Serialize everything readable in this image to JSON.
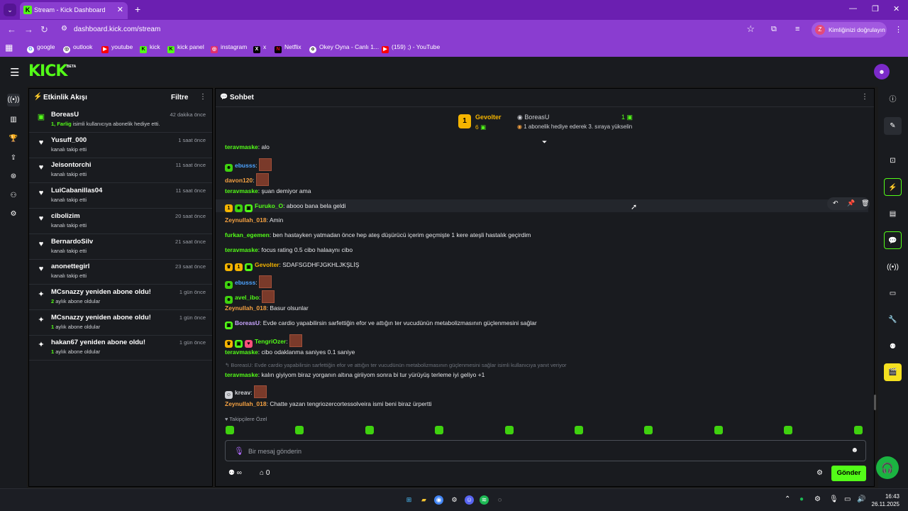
{
  "browser": {
    "tab_title": "Stream - Kick Dashboard",
    "url": "dashboard.kick.com/stream",
    "profile_label": "Kimliğinizi doğrulayın",
    "profile_initial": "Z",
    "bookmarks": [
      "google",
      "outlook",
      "youtube",
      "kick",
      "kick panel",
      "instagram",
      "x",
      "Netflix",
      "Okey Oyna - Canlı 1...",
      "(159) ;) - YouTube"
    ]
  },
  "kick": {
    "logo": "KICK",
    "beta": "BETA"
  },
  "activity": {
    "title": "Etkinlik Akışı",
    "filter_label": "Filtre",
    "events": [
      {
        "icon": "gift-icon",
        "name": "BoreasU",
        "sub_strong": "1, Farlig",
        "sub": " isimli kullanıcıya abonelik hediye etti.",
        "time": "42 dakika önce",
        "color": "#53fc18"
      },
      {
        "icon": "heart-icon",
        "name": "Yusuff_000",
        "sub_strong": "",
        "sub": "kanalı takip etti",
        "time": "1 saat önce",
        "color": "#ffffff"
      },
      {
        "icon": "heart-icon",
        "name": "Jeisontorchi",
        "sub_strong": "",
        "sub": "kanalı takip etti",
        "time": "11 saat önce",
        "color": "#ffffff"
      },
      {
        "icon": "heart-icon",
        "name": "LuiCabanillas04",
        "sub_strong": "",
        "sub": "kanalı takip etti",
        "time": "11 saat önce",
        "color": "#ffffff"
      },
      {
        "icon": "heart-icon",
        "name": "cibolizim",
        "sub_strong": "",
        "sub": "kanalı takip etti",
        "time": "20 saat önce",
        "color": "#ffffff"
      },
      {
        "icon": "heart-icon",
        "name": "BernardoSilv",
        "sub_strong": "",
        "sub": "kanalı takip etti",
        "time": "21 saat önce",
        "color": "#ffffff"
      },
      {
        "icon": "heart-icon",
        "name": "anonettegirl",
        "sub_strong": "",
        "sub": "kanalı takip etti",
        "time": "23 saat önce",
        "color": "#ffffff"
      },
      {
        "icon": "sparkle-icon",
        "name": "MCsnazzy yeniden abone oldu!",
        "sub_strong": "2",
        "sub": " aylık abone oldular",
        "time": "1 gün önce",
        "color": "#ffffff"
      },
      {
        "icon": "sparkle-icon",
        "name": "MCsnazzy yeniden abone oldu!",
        "sub_strong": "1",
        "sub": " aylık abone oldular",
        "time": "1 gün önce",
        "color": "#ffffff"
      },
      {
        "icon": "sparkle-icon",
        "name": "hakan67 yeniden abone oldu!",
        "sub_strong": "1",
        "sub": " aylık abone oldular",
        "time": "1 gün önce",
        "color": "#ffffff"
      }
    ]
  },
  "chat": {
    "title": "Sohbet",
    "pinned": {
      "rank_badge": "1",
      "name": "Gevolter",
      "count": "6",
      "user": "BoreasU",
      "rank": "1",
      "desc": "1 abonelik hediye ederek 3. sıraya yükselin"
    },
    "messages": [
      {
        "user": "teravmaske",
        "color": "#53fc18",
        "text": ": alo",
        "emote": false,
        "badges": []
      },
      {
        "user": "ebusss",
        "color": "#4da3ff",
        "text": ":",
        "emote": true,
        "badges": [
          "frog"
        ]
      },
      {
        "user": "davon120",
        "color": "#f4a142",
        "text": ":",
        "emote": true,
        "badges": []
      },
      {
        "user": "teravmaske",
        "color": "#53fc18",
        "text": ": şuan demiyor ama",
        "emote": false,
        "badges": []
      },
      {
        "user": "Furuko_O",
        "color": "#53fc18",
        "text": ": abooo bana bela geldi",
        "emote": false,
        "badges": [
          "gold",
          "frog",
          "gift"
        ]
      },
      {
        "user": "Zeynullah_018",
        "color": "#f4a142",
        "text": ": Amin",
        "emote": false,
        "badges": []
      },
      {
        "user": "furkan_egemen",
        "color": "#53fc18",
        "text": ": ben hastayken yatmadan önce hep ateş düşürücü içerim geçmişte 1 kere ateşli hastalık geçirdim",
        "emote": false,
        "badges": []
      },
      {
        "user": "teravmaske",
        "color": "#53fc18",
        "text": ": focus rating 0.5 cibo halaaynı cibo",
        "emote": false,
        "badges": []
      },
      {
        "user": "Gevolter",
        "color": "#f4b400",
        "text": ": SDAFSGDHFJGKHLJKŞLİŞ",
        "emote": false,
        "badges": [
          "crown",
          "gold",
          "gift"
        ]
      },
      {
        "user": "ebusss",
        "color": "#4da3ff",
        "text": ":",
        "emote": true,
        "badges": [
          "frog"
        ]
      },
      {
        "user": "avel_ibo",
        "color": "#53fc18",
        "text": ":",
        "emote": true,
        "badges": [
          "frog"
        ]
      },
      {
        "user": "Zeynullah_018",
        "color": "#f4a142",
        "text": ": Basur olsunlar",
        "emote": false,
        "badges": []
      },
      {
        "user": "BoreasU",
        "color": "#c9a5ff",
        "text": ": Evde cardio yapabilirsin sarfettiğin efor ve attığın ter vucudünün metabolizmasının güçlenmesini sağlar",
        "emote": false,
        "badges": [
          "gift"
        ]
      },
      {
        "user": "TengriOzer",
        "color": "#53fc18",
        "text": ":",
        "emote": true,
        "badges": [
          "crown",
          "gift",
          "heart"
        ]
      },
      {
        "user": "teravmaske",
        "color": "#53fc18",
        "text": ": cibo odaklanma saniyes 0.1 saniye",
        "emote": false,
        "badges": []
      },
      {
        "user": "teravmaske",
        "color": "#53fc18",
        "text": ": kalın giyiyom biraz yorganın altına giriiyom sonra bi tur yürüyüş terleme iyi geliyo +1",
        "emote": false,
        "badges": []
      },
      {
        "user": "kreav",
        "color": "#cfd1d6",
        "text": ":",
        "emote": true,
        "badges": [
          "face"
        ]
      },
      {
        "user": "Zeynullah_018",
        "color": "#f4a142",
        "text": ": Chatte yazan tengriozercortessolveira ismi beni biraz ürpertti",
        "emote": false,
        "badges": []
      }
    ],
    "reply_context": "↰ BoreasU: Evde cardio yapabilirsin sarfettiğin efor ve attığın ter vucudünün metabolizmasının güçlenmesini sağlar isimli kullanıcıya yanıt veriyor",
    "subscribers_label": "♥ Takipçilere Özel",
    "input_placeholder": "Bir mesaj gönderin",
    "points": "∞",
    "store_count": "0",
    "send_label": "Gönder"
  },
  "taskbar": {
    "time": "16:43",
    "date": "26.11.2025"
  },
  "colors": {
    "accent": "#53fc18",
    "browser": "#8a3dd0",
    "panel": "#191b1f"
  }
}
